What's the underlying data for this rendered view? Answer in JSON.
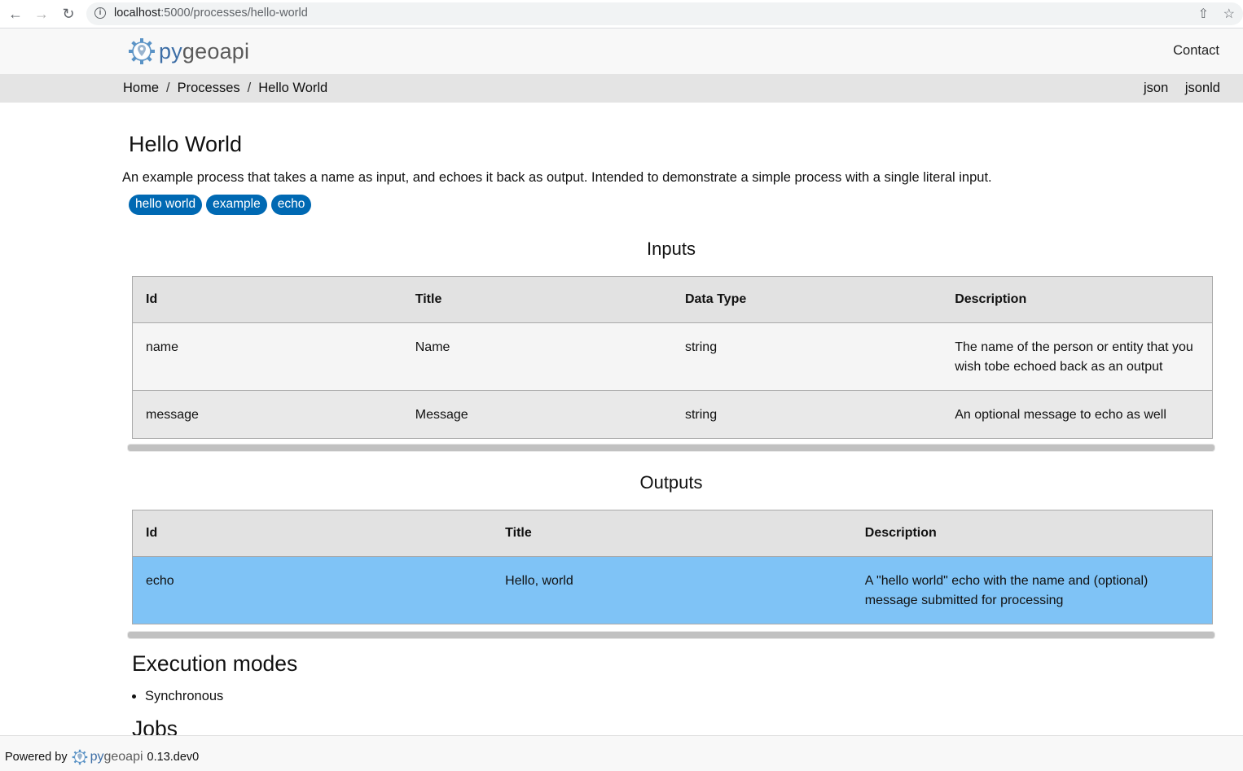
{
  "browser": {
    "url_host": "localhost",
    "url_rest": ":5000/processes/hello-world"
  },
  "header": {
    "logo_py": "py",
    "logo_geo": "geoapi",
    "contact": "Contact"
  },
  "breadcrumb": {
    "items": [
      "Home",
      "Processes",
      "Hello World"
    ],
    "separator": "/",
    "formats": [
      "json",
      "jsonld"
    ]
  },
  "process": {
    "title": "Hello World",
    "description": "An example process that takes a name as input, and echoes it back as output. Intended to demonstrate a simple process with a single literal input.",
    "keywords": [
      "hello world",
      "example",
      "echo"
    ],
    "tag_color": "#0069b3"
  },
  "inputs": {
    "heading": "Inputs",
    "columns": [
      "Id",
      "Title",
      "Data Type",
      "Description"
    ],
    "rows": [
      {
        "id": "name",
        "title": "Name",
        "type": "string",
        "desc": "The name of the person or entity that you wish tobe echoed back as an output"
      },
      {
        "id": "message",
        "title": "Message",
        "type": "string",
        "desc": "An optional message to echo as well"
      }
    ]
  },
  "outputs": {
    "heading": "Outputs",
    "columns": [
      "Id",
      "Title",
      "Description"
    ],
    "rows": [
      {
        "id": "echo",
        "title": "Hello, world",
        "desc": "A \"hello world\" echo with the name and (optional) message submitted for processing"
      }
    ],
    "highlight_color": "#7fc3f6"
  },
  "execution": {
    "heading": "Execution modes",
    "modes": [
      "Synchronous"
    ]
  },
  "jobs": {
    "heading": "Jobs"
  },
  "footer": {
    "powered_by": "Powered by",
    "logo_py": "py",
    "logo_geo": "geoapi",
    "version": "0.13.dev0"
  }
}
